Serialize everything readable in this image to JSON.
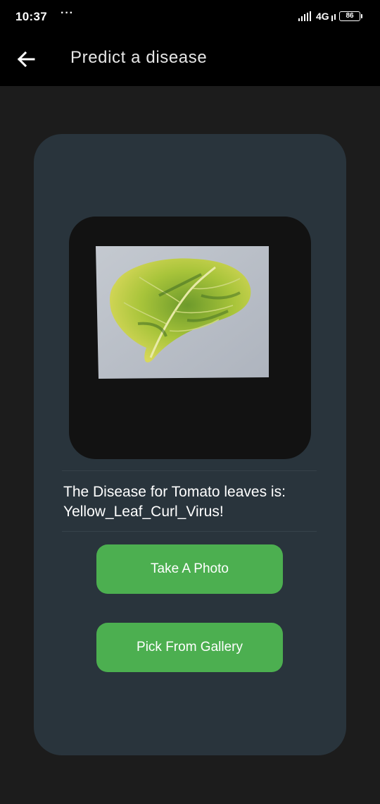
{
  "status_bar": {
    "time": "10:37",
    "dots": "···",
    "network": "4G",
    "battery": "86",
    "icons": [
      "signal-icon",
      "network-arrows-icon",
      "battery-icon"
    ]
  },
  "app_bar": {
    "back_icon": "arrow-left-icon",
    "title": "Predict a disease"
  },
  "card": {
    "image_content": "tomato leaf photo",
    "result_line1": "The Disease for Tomato leaves is:",
    "result_line2": "Yellow_Leaf_Curl_Virus!",
    "take_photo_label": "Take A Photo",
    "gallery_label": "Pick From Gallery"
  },
  "colors": {
    "background": "#1c1c1c",
    "bar": "#000000",
    "card": "#29343c",
    "button": "#4caf50",
    "text": "#ffffff"
  }
}
